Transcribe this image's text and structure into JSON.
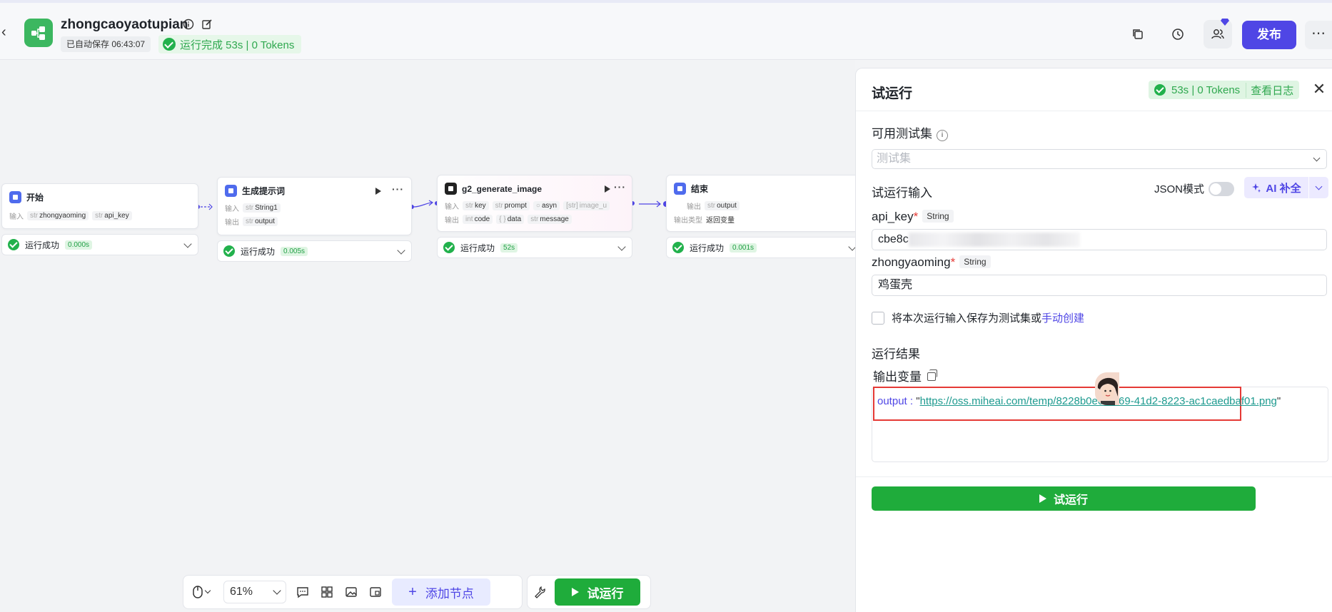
{
  "header": {
    "app_title": "zhongcaoyaotupian",
    "autosave": "已自动保存 06:43:07",
    "run_status": "运行完成 53s | 0 Tokens",
    "publish": "发布",
    "more": "⋯"
  },
  "canvas": {
    "nodes": [
      {
        "title": "开始",
        "input_label": "输入",
        "inputs": [
          "zhongyaoming",
          "api_key"
        ],
        "result": "运行成功",
        "time": "0.000s"
      },
      {
        "title": "生成提示词",
        "input_label": "输入",
        "inputs": [
          "String1"
        ],
        "output_label": "输出",
        "outputs": [
          "output"
        ],
        "result": "运行成功",
        "time": "0.005s"
      },
      {
        "title": "g2_generate_image",
        "input_label": "输入",
        "inputs": [
          "key",
          "prompt",
          "asyn",
          "image_u"
        ],
        "output_label": "输出",
        "outputs": [
          "code",
          "data",
          "message"
        ],
        "result": "运行成功",
        "time": "52s"
      },
      {
        "title": "结束",
        "output_label": "输出",
        "outputs": [
          "output"
        ],
        "output_type_label": "输出类型",
        "output_type": "返回变量",
        "result": "运行成功",
        "time": "0.001s"
      }
    ],
    "toolbar": {
      "zoom": "61%",
      "add_node": "添加节点",
      "run": "试运行"
    }
  },
  "panel": {
    "title": "试运行",
    "status_time": "53s | 0 Tokens",
    "view_log": "查看日志",
    "test_set_label": "可用测试集",
    "test_set_placeholder": "测试集",
    "run_input_label": "试运行输入",
    "json_mode": "JSON模式",
    "ai_complete": "AI 补全",
    "fields": [
      {
        "name": "api_key",
        "type": "String",
        "value": "cbe8c"
      },
      {
        "name": "zhongyaoming",
        "type": "String",
        "value": "鸡蛋壳"
      }
    ],
    "save_checkbox": "将本次运行输入保存为测试集或",
    "save_link": "手动创建",
    "result_label": "运行结果",
    "output_var_label": "输出变量",
    "output_key": "output",
    "output_value": "https://oss.miheai.com/temp/8228b0ec-0b69-41d2-8223-ac1caedbaf01.png",
    "run_button": "试运行"
  },
  "colors": {
    "primary": "#4f46e5",
    "success": "#1fac3b",
    "highlight": "#e53935"
  }
}
